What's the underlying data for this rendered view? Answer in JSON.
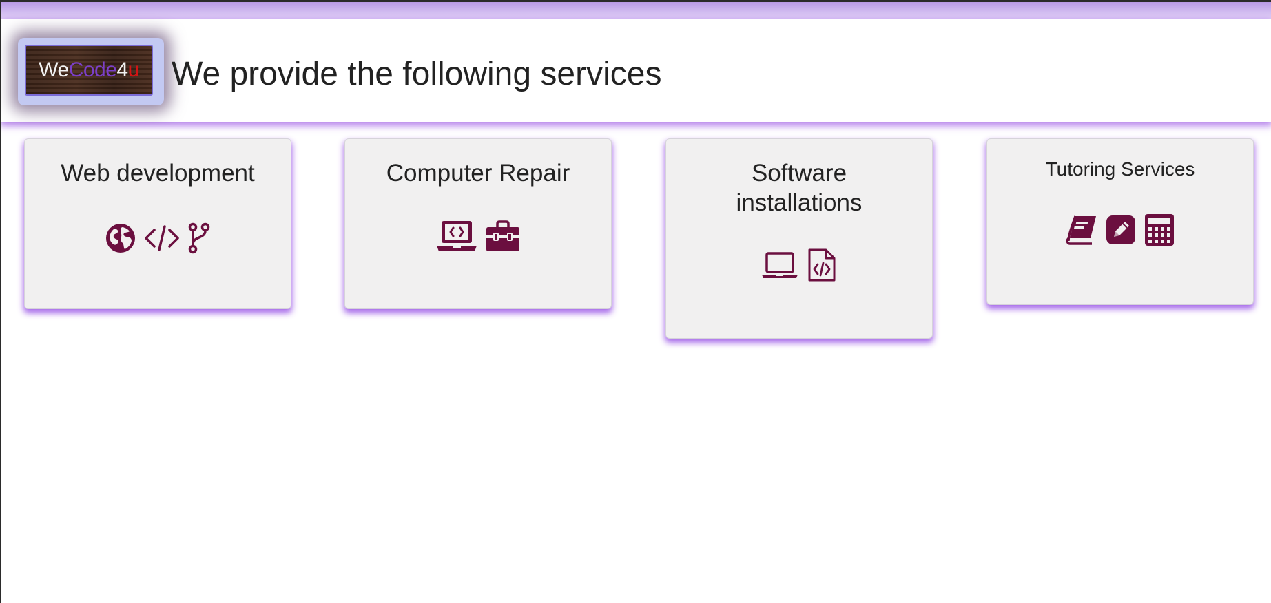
{
  "header": {
    "logo": {
      "part_we": "We",
      "part_code": "Code",
      "part_4": "4",
      "part_u": "u"
    },
    "title": "We provide the following services"
  },
  "services": [
    {
      "title": "Web development",
      "icons": [
        "globe-icon",
        "code-icon",
        "code-branch-icon"
      ]
    },
    {
      "title": "Computer Repair",
      "icons": [
        "laptop-code-icon",
        "toolbox-icon"
      ]
    },
    {
      "title": "Software installations",
      "icons": [
        "laptop-icon",
        "file-code-icon"
      ]
    },
    {
      "title": "Tutoring Services",
      "icons": [
        "book-icon",
        "pen-square-icon",
        "calculator-icon"
      ]
    }
  ],
  "colors": {
    "accent_shadow": "#a05fe6",
    "icon": "#6b0f3f",
    "card_bg": "#f1f0f0"
  }
}
